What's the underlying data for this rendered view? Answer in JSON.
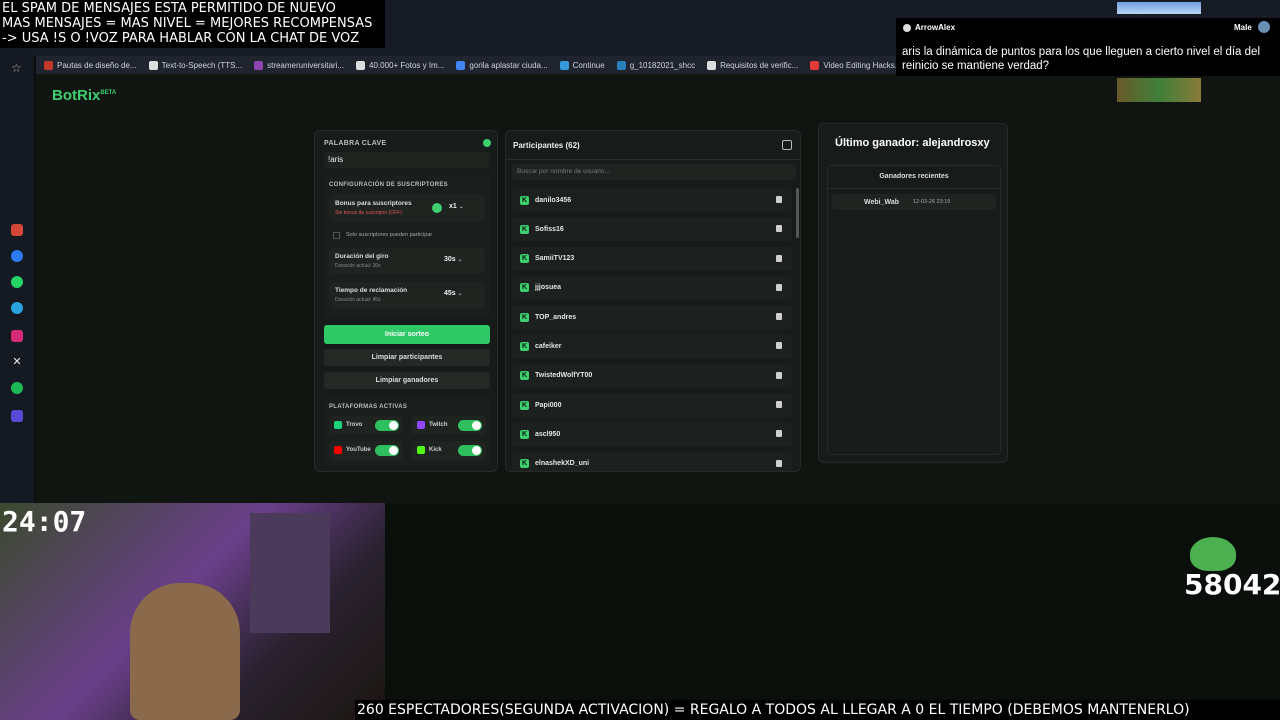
{
  "overlay": {
    "banner_lines": [
      "EL SPAM DE MENSAJES ESTA PERMITIDO DE NUEVO",
      "MAS MENSAJES = MAS NIVEL = MEJORES RECOMPENSAS",
      "-> USA !S O !VOZ PARA HABLAR CON LA CHAT DE VOZ"
    ],
    "timer": "24:07",
    "points": "58042",
    "ticker": "260 ESPECTADORES(SEGUNDA ACTIVACION) = REGALO A TODOS AL LLEGAR A 0 EL TIEMPO (DEBEMOS MANTENERLO)"
  },
  "chat": {
    "username": "ArrowAlex",
    "tag": "Male",
    "message": "aris la dinámica de puntos para los que lleguen a cierto nivel el día del reinicio se mantiene verdad?"
  },
  "bookmarks": [
    {
      "label": "Pautas de diseño de...",
      "color": "#c0392b"
    },
    {
      "label": "Text-to-Speech (TTS...",
      "color": "#dddddd"
    },
    {
      "label": "streameruniversitari...",
      "color": "#8e44ad"
    },
    {
      "label": "40.000+ Fotos y Im...",
      "color": "#dddddd"
    },
    {
      "label": "gorila aplastar ciuda...",
      "color": "#4285f4"
    },
    {
      "label": "Continue",
      "color": "#3498db"
    },
    {
      "label": "g_10182021_shcc",
      "color": "#2980b9"
    },
    {
      "label": "Requisitos de verific...",
      "color": "#dddddd"
    },
    {
      "label": "Video Editing Hacks...",
      "color": "#e53935"
    }
  ],
  "app": {
    "logo": "BotRix",
    "logo_badge": "BETA",
    "keyword_label": "PALABRA CLAVE",
    "keyword_value": "!aris",
    "sub_config_label": "CONFIGURACIÓN DE SUSCRIPTORES",
    "sub_bonus_title": "Bonus para suscriptores",
    "sub_bonus_sub": "Sin bonus de suscriptor (OFF)",
    "sub_bonus_value": "x1",
    "subs_only_label": "Solo suscriptores pueden participar",
    "spin_title": "Duración del giro",
    "spin_sub": "Duración actual: 30s",
    "spin_value": "30s",
    "claim_title": "Tiempo de reclamación",
    "claim_sub": "Duración actual: 45s",
    "claim_value": "45s",
    "start_button": "Iniciar sorteo",
    "clear_participants_button": "Limpiar participantes",
    "clear_winners_button": "Limpiar ganadores",
    "platforms_label": "PLATAFORMAS ACTIVAS",
    "platforms": [
      {
        "name": "Trovo",
        "color": "#1ed47a"
      },
      {
        "name": "Twitch",
        "color": "#9146ff"
      },
      {
        "name": "YouTube",
        "color": "#ff0000"
      },
      {
        "name": "Kick",
        "color": "#53fc18"
      }
    ],
    "participants_title": "Participantes (62)",
    "search_placeholder": "Buscar por nombre de usuario...",
    "participants": [
      "danilo3456",
      "Sofiss16",
      "SamiiTV123",
      "jjjosuea",
      "TOP_andres",
      "cafeiker",
      "TwistedWolfYT00",
      "Papi000",
      "ascl950",
      "elnashekXD_uni"
    ],
    "last_winner": "Último ganador: alejandrosxy",
    "recent_winners_label": "Ganadores recientes",
    "recent_winners": [
      {
        "name": "Webi_Wab",
        "time": "12-03-26 23:19"
      }
    ]
  }
}
